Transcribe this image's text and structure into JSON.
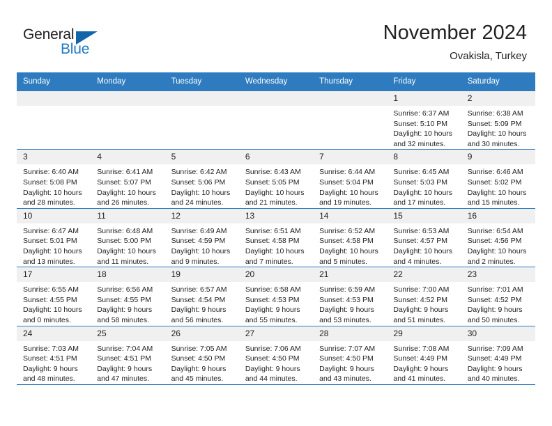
{
  "brand": {
    "name_part1": "General",
    "name_part2": "Blue",
    "triangle_color": "#1464aa",
    "blue_color": "#1f7ac4"
  },
  "header": {
    "title": "November 2024",
    "subtitle": "Ovakisla, Turkey"
  },
  "theme": {
    "header_bg": "#2e7cbf",
    "daynum_bg": "#f0f0f0",
    "grid_line": "#2e7cbf",
    "text": "#222222"
  },
  "weekday_headers": [
    "Sunday",
    "Monday",
    "Tuesday",
    "Wednesday",
    "Thursday",
    "Friday",
    "Saturday"
  ],
  "weeks": [
    [
      {
        "day": "",
        "empty": true,
        "sunrise": "",
        "sunset": "",
        "daylight": ""
      },
      {
        "day": "",
        "empty": true,
        "sunrise": "",
        "sunset": "",
        "daylight": ""
      },
      {
        "day": "",
        "empty": true,
        "sunrise": "",
        "sunset": "",
        "daylight": ""
      },
      {
        "day": "",
        "empty": true,
        "sunrise": "",
        "sunset": "",
        "daylight": ""
      },
      {
        "day": "",
        "empty": true,
        "sunrise": "",
        "sunset": "",
        "daylight": ""
      },
      {
        "day": "1",
        "empty": false,
        "sunrise": "Sunrise: 6:37 AM",
        "sunset": "Sunset: 5:10 PM",
        "daylight": "Daylight: 10 hours and 32 minutes."
      },
      {
        "day": "2",
        "empty": false,
        "sunrise": "Sunrise: 6:38 AM",
        "sunset": "Sunset: 5:09 PM",
        "daylight": "Daylight: 10 hours and 30 minutes."
      }
    ],
    [
      {
        "day": "3",
        "empty": false,
        "sunrise": "Sunrise: 6:40 AM",
        "sunset": "Sunset: 5:08 PM",
        "daylight": "Daylight: 10 hours and 28 minutes."
      },
      {
        "day": "4",
        "empty": false,
        "sunrise": "Sunrise: 6:41 AM",
        "sunset": "Sunset: 5:07 PM",
        "daylight": "Daylight: 10 hours and 26 minutes."
      },
      {
        "day": "5",
        "empty": false,
        "sunrise": "Sunrise: 6:42 AM",
        "sunset": "Sunset: 5:06 PM",
        "daylight": "Daylight: 10 hours and 24 minutes."
      },
      {
        "day": "6",
        "empty": false,
        "sunrise": "Sunrise: 6:43 AM",
        "sunset": "Sunset: 5:05 PM",
        "daylight": "Daylight: 10 hours and 21 minutes."
      },
      {
        "day": "7",
        "empty": false,
        "sunrise": "Sunrise: 6:44 AM",
        "sunset": "Sunset: 5:04 PM",
        "daylight": "Daylight: 10 hours and 19 minutes."
      },
      {
        "day": "8",
        "empty": false,
        "sunrise": "Sunrise: 6:45 AM",
        "sunset": "Sunset: 5:03 PM",
        "daylight": "Daylight: 10 hours and 17 minutes."
      },
      {
        "day": "9",
        "empty": false,
        "sunrise": "Sunrise: 6:46 AM",
        "sunset": "Sunset: 5:02 PM",
        "daylight": "Daylight: 10 hours and 15 minutes."
      }
    ],
    [
      {
        "day": "10",
        "empty": false,
        "sunrise": "Sunrise: 6:47 AM",
        "sunset": "Sunset: 5:01 PM",
        "daylight": "Daylight: 10 hours and 13 minutes."
      },
      {
        "day": "11",
        "empty": false,
        "sunrise": "Sunrise: 6:48 AM",
        "sunset": "Sunset: 5:00 PM",
        "daylight": "Daylight: 10 hours and 11 minutes."
      },
      {
        "day": "12",
        "empty": false,
        "sunrise": "Sunrise: 6:49 AM",
        "sunset": "Sunset: 4:59 PM",
        "daylight": "Daylight: 10 hours and 9 minutes."
      },
      {
        "day": "13",
        "empty": false,
        "sunrise": "Sunrise: 6:51 AM",
        "sunset": "Sunset: 4:58 PM",
        "daylight": "Daylight: 10 hours and 7 minutes."
      },
      {
        "day": "14",
        "empty": false,
        "sunrise": "Sunrise: 6:52 AM",
        "sunset": "Sunset: 4:58 PM",
        "daylight": "Daylight: 10 hours and 5 minutes."
      },
      {
        "day": "15",
        "empty": false,
        "sunrise": "Sunrise: 6:53 AM",
        "sunset": "Sunset: 4:57 PM",
        "daylight": "Daylight: 10 hours and 4 minutes."
      },
      {
        "day": "16",
        "empty": false,
        "sunrise": "Sunrise: 6:54 AM",
        "sunset": "Sunset: 4:56 PM",
        "daylight": "Daylight: 10 hours and 2 minutes."
      }
    ],
    [
      {
        "day": "17",
        "empty": false,
        "sunrise": "Sunrise: 6:55 AM",
        "sunset": "Sunset: 4:55 PM",
        "daylight": "Daylight: 10 hours and 0 minutes."
      },
      {
        "day": "18",
        "empty": false,
        "sunrise": "Sunrise: 6:56 AM",
        "sunset": "Sunset: 4:55 PM",
        "daylight": "Daylight: 9 hours and 58 minutes."
      },
      {
        "day": "19",
        "empty": false,
        "sunrise": "Sunrise: 6:57 AM",
        "sunset": "Sunset: 4:54 PM",
        "daylight": "Daylight: 9 hours and 56 minutes."
      },
      {
        "day": "20",
        "empty": false,
        "sunrise": "Sunrise: 6:58 AM",
        "sunset": "Sunset: 4:53 PM",
        "daylight": "Daylight: 9 hours and 55 minutes."
      },
      {
        "day": "21",
        "empty": false,
        "sunrise": "Sunrise: 6:59 AM",
        "sunset": "Sunset: 4:53 PM",
        "daylight": "Daylight: 9 hours and 53 minutes."
      },
      {
        "day": "22",
        "empty": false,
        "sunrise": "Sunrise: 7:00 AM",
        "sunset": "Sunset: 4:52 PM",
        "daylight": "Daylight: 9 hours and 51 minutes."
      },
      {
        "day": "23",
        "empty": false,
        "sunrise": "Sunrise: 7:01 AM",
        "sunset": "Sunset: 4:52 PM",
        "daylight": "Daylight: 9 hours and 50 minutes."
      }
    ],
    [
      {
        "day": "24",
        "empty": false,
        "sunrise": "Sunrise: 7:03 AM",
        "sunset": "Sunset: 4:51 PM",
        "daylight": "Daylight: 9 hours and 48 minutes."
      },
      {
        "day": "25",
        "empty": false,
        "sunrise": "Sunrise: 7:04 AM",
        "sunset": "Sunset: 4:51 PM",
        "daylight": "Daylight: 9 hours and 47 minutes."
      },
      {
        "day": "26",
        "empty": false,
        "sunrise": "Sunrise: 7:05 AM",
        "sunset": "Sunset: 4:50 PM",
        "daylight": "Daylight: 9 hours and 45 minutes."
      },
      {
        "day": "27",
        "empty": false,
        "sunrise": "Sunrise: 7:06 AM",
        "sunset": "Sunset: 4:50 PM",
        "daylight": "Daylight: 9 hours and 44 minutes."
      },
      {
        "day": "28",
        "empty": false,
        "sunrise": "Sunrise: 7:07 AM",
        "sunset": "Sunset: 4:50 PM",
        "daylight": "Daylight: 9 hours and 43 minutes."
      },
      {
        "day": "29",
        "empty": false,
        "sunrise": "Sunrise: 7:08 AM",
        "sunset": "Sunset: 4:49 PM",
        "daylight": "Daylight: 9 hours and 41 minutes."
      },
      {
        "day": "30",
        "empty": false,
        "sunrise": "Sunrise: 7:09 AM",
        "sunset": "Sunset: 4:49 PM",
        "daylight": "Daylight: 9 hours and 40 minutes."
      }
    ]
  ]
}
